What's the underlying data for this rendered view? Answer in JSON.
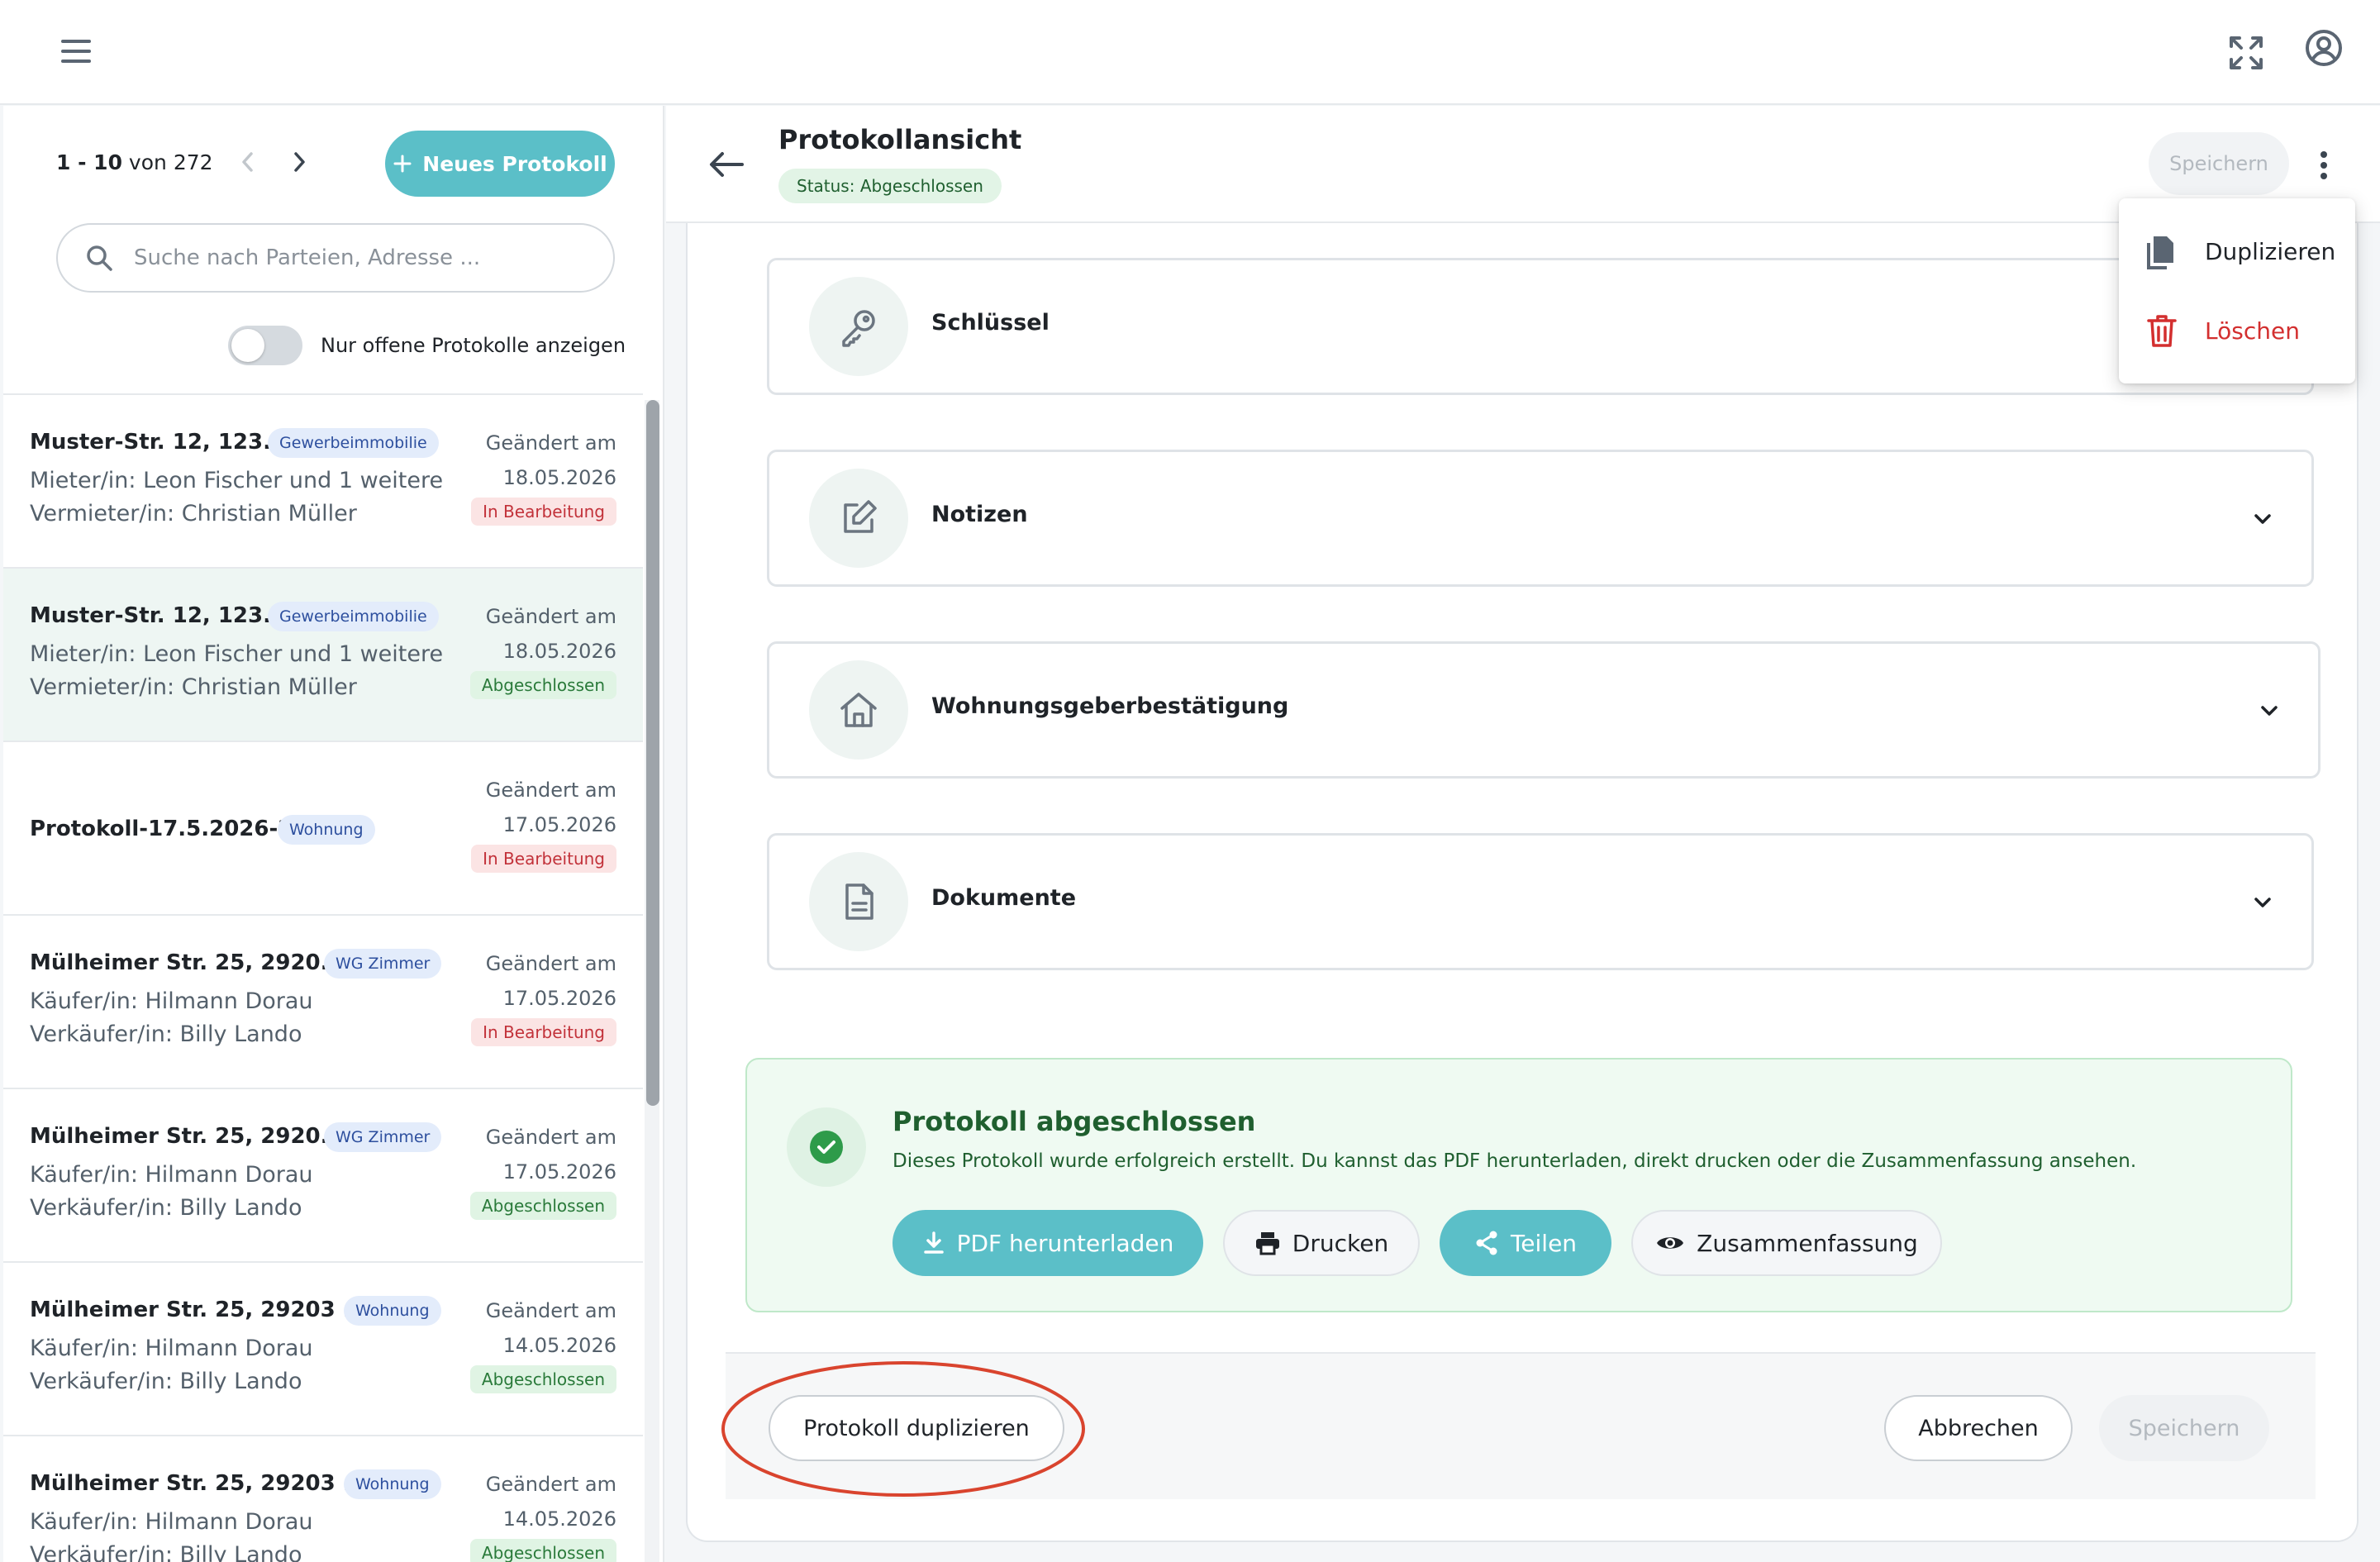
{
  "pager": {
    "range": "1 - 10",
    "of_label": "von",
    "total": "272"
  },
  "new_button_label": "Neues Protokoll",
  "search": {
    "placeholder": "Suche nach Parteien, Adresse ..."
  },
  "filter_toggle": {
    "label": "Nur offene Protokolle anzeigen",
    "checked": false
  },
  "list": [
    {
      "title": "Muster-Str. 12, 123...",
      "badge": "Gewerbeimmobilie",
      "line1": "Mieter/in: Leon Fischer und 1 weitere",
      "line2": "Vermieter/in: Christian Müller",
      "changed": "Geändert am",
      "date": "18.05.2026",
      "status": "In Bearbeitung"
    },
    {
      "title": "Muster-Str. 12, 123...",
      "badge": "Gewerbeimmobilie",
      "line1": "Mieter/in: Leon Fischer und 1 weitere",
      "line2": "Vermieter/in: Christian Müller",
      "changed": "Geändert am",
      "date": "18.05.2026",
      "status": "Abgeschlossen"
    },
    {
      "title": "Protokoll-17.5.2026-2",
      "badge": "Wohnung",
      "line1": "",
      "line2": "",
      "changed": "Geändert am",
      "date": "17.05.2026",
      "status": "In Bearbeitung"
    },
    {
      "title": "Mülheimer Str. 25, 2920...",
      "badge": "WG Zimmer",
      "line1": "Käufer/in: Hilmann Dorau",
      "line2": "Verkäufer/in: Billy Lando",
      "changed": "Geändert am",
      "date": "17.05.2026",
      "status": "In Bearbeitung"
    },
    {
      "title": "Mülheimer Str. 25, 2920...",
      "badge": "WG Zimmer",
      "line1": "Käufer/in: Hilmann Dorau",
      "line2": "Verkäufer/in: Billy Lando",
      "changed": "Geändert am",
      "date": "17.05.2026",
      "status": "Abgeschlossen"
    },
    {
      "title": "Mülheimer Str. 25, 29203 ...",
      "badge": "Wohnung",
      "line1": "Käufer/in: Hilmann Dorau",
      "line2": "Verkäufer/in: Billy Lando",
      "changed": "Geändert am",
      "date": "14.05.2026",
      "status": "Abgeschlossen"
    },
    {
      "title": "Mülheimer Str. 25, 29203 ...",
      "badge": "Wohnung",
      "line1": "Käufer/in: Hilmann Dorau",
      "line2": "Verkäufer/in: Billy Lando",
      "changed": "Geändert am",
      "date": "14.05.2026",
      "status": "Abgeschlossen"
    }
  ],
  "detail": {
    "title": "Protokollansicht",
    "status_label": "Status:",
    "status_value": "Abgeschlossen",
    "save_label": "Speichern"
  },
  "sections": [
    {
      "label": "Schlüssel",
      "icon": "key-icon"
    },
    {
      "label": "Notizen",
      "icon": "edit-note-icon"
    },
    {
      "label": "Wohnungsgeberbestätigung",
      "icon": "house-icon"
    },
    {
      "label": "Dokumente",
      "icon": "document-icon"
    }
  ],
  "success": {
    "title": "Protokoll abgeschlossen",
    "text": "Dieses Protokoll wurde erfolgreich erstellt. Du kannst das PDF herunterladen, direkt drucken oder die Zusammenfassung ansehen.",
    "pdf_label": "PDF herunterladen",
    "print_label": "Drucken",
    "share_label": "Teilen",
    "summary_label": "Zusammenfassung"
  },
  "footer": {
    "duplicate_label": "Protokoll duplizieren",
    "cancel_label": "Abbrechen",
    "save_label": "Speichern"
  },
  "menu": {
    "duplicate_label": "Duplizieren",
    "delete_label": "Löschen"
  },
  "colors": {
    "accent": "#5bbfc8",
    "success_bg": "#effaf2",
    "danger": "#d32f2f",
    "annotation": "#d9442e"
  }
}
